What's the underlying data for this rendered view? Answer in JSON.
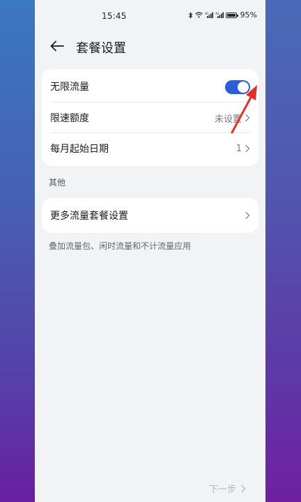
{
  "status_bar": {
    "time": "15:45",
    "battery_text": "95%",
    "icons": [
      "bluetooth-icon",
      "wifi-icon",
      "signal-icon",
      "signal-icon",
      "battery-icon"
    ]
  },
  "header": {
    "title": "套餐设置"
  },
  "main_card": {
    "rows": [
      {
        "label": "无限流量",
        "type": "toggle",
        "enabled": true
      },
      {
        "label": "限速额度",
        "value": "未设置"
      },
      {
        "label": "每月起始日期",
        "value": "1"
      }
    ]
  },
  "other_section": {
    "label": "其他",
    "more_row_label": "更多流量套餐设置",
    "helper": "叠加流量包、闲时流量和不计流量应用"
  },
  "footer": {
    "next_label": "下一步"
  },
  "colors": {
    "toggle_on": "#2a5fd6",
    "annotation_arrow": "#e0312b"
  }
}
